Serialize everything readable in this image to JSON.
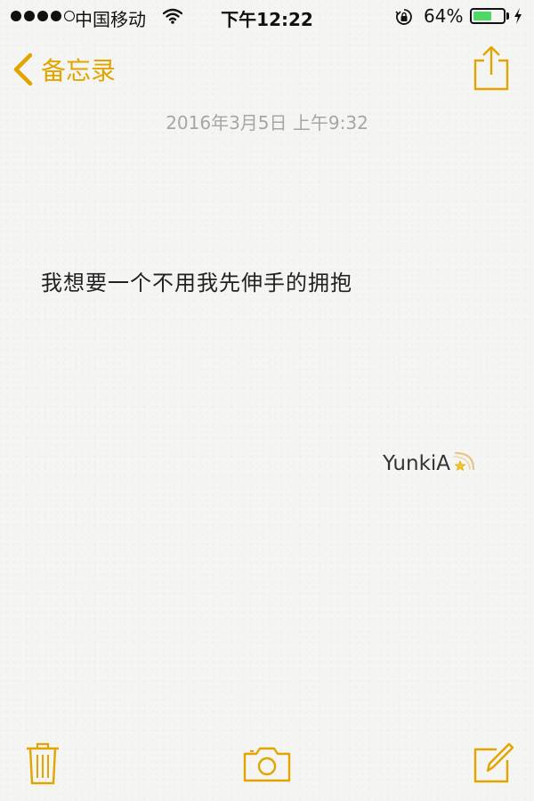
{
  "status_bar": {
    "signal_bars_filled": 4,
    "signal_bars_total": 5,
    "carrier": "中国移动",
    "time": "下午12:22",
    "battery_percent_label": "64%",
    "battery_level": 0.64,
    "battery_color": "#4cd964"
  },
  "nav": {
    "back_label": "备忘录",
    "accent_color": "#e2a500",
    "share_icon": "share-icon"
  },
  "note": {
    "date": "2016年3月5日 上午9:32",
    "body": "我想要一个不用我先伸手的拥抱",
    "signature": "YunkiA",
    "signature_emoji": "shooting-star"
  },
  "toolbar": {
    "trash_icon": "trash-icon",
    "camera_icon": "camera-icon",
    "compose_icon": "compose-icon"
  }
}
